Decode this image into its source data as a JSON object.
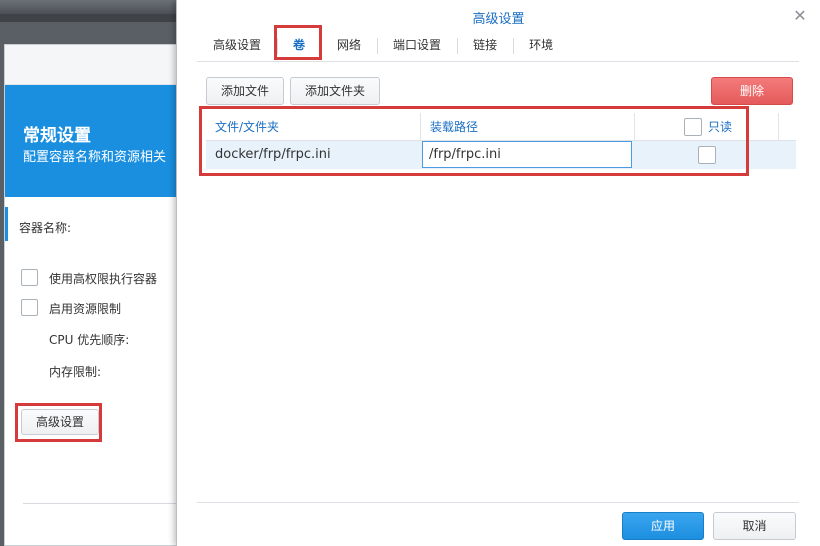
{
  "background_window": {
    "title": "常规设置",
    "subtitle": "配置容器名称和资源相关",
    "container_name_label": "容器名称:",
    "privileged_label": "使用高权限执行容器",
    "resource_limit_label": "启用资源限制",
    "cpu_priority_label": "CPU 优先顺序:",
    "memory_limit_label": "内存限制:",
    "advanced_button": "高级设置"
  },
  "dialog": {
    "title": "高级设置",
    "tabs": [
      {
        "label": "高级设置",
        "active": false
      },
      {
        "label": "卷",
        "active": true
      },
      {
        "label": "网络",
        "active": false
      },
      {
        "label": "端口设置",
        "active": false
      },
      {
        "label": "链接",
        "active": false
      },
      {
        "label": "环境",
        "active": false
      }
    ],
    "toolbar": {
      "add_file": "添加文件",
      "add_folder": "添加文件夹",
      "delete": "删除"
    },
    "table": {
      "columns": [
        "文件/文件夹",
        "装载路径",
        "只读"
      ],
      "rows": [
        {
          "file": "docker/frp/frpc.ini",
          "mount_path": "/frp/frpc.ini",
          "read_only": false
        }
      ]
    },
    "footer": {
      "apply": "应用",
      "cancel": "取消"
    }
  },
  "colors": {
    "accent": "#1a8fe0",
    "highlight": "#d63b3b",
    "danger": "#e55a5a"
  }
}
